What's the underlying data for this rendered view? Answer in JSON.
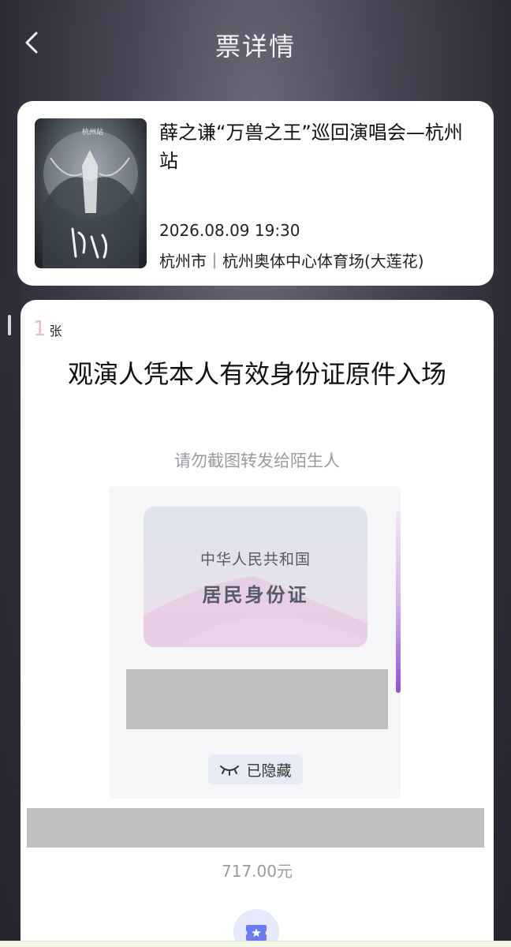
{
  "header": {
    "title": "票详情",
    "back_icon": "chevron-left-icon"
  },
  "event": {
    "title": "薛之谦“万兽之王”巡回演唱会—杭州站",
    "datetime": "2026.08.09 19:30",
    "venue": "杭州市｜杭州奥体中心体育场(大莲花)",
    "poster_caption": "杭州站"
  },
  "ticket": {
    "quantity": "1",
    "quantity_unit": "张",
    "entry_notice": "观演人凭本人有效身份证原件入场",
    "screenshot_warning": "请勿截图转发给陌生人",
    "id_card": {
      "country": "中华人民共和国",
      "type": "居民身份证"
    },
    "hidden_label": "已隐藏",
    "hidden_icon": "closed-eye-icon",
    "price": "717.00元",
    "bottom_icon": "ticket-star-icon"
  },
  "colors": {
    "accent_purple": "#8b53d1",
    "quantity_pink": "#e7b9d8",
    "muted_text": "#9a9aa0",
    "redaction_gray": "#bfbfbf"
  }
}
